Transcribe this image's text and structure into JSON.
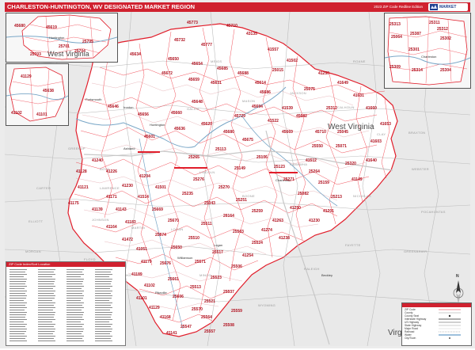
{
  "title": "CHARLESTON-HUNTINGTON, WV DESIGNATED MARKET REGION",
  "edition_note": "2023 ZIP Code Redline Edition",
  "logo_text": "MARKET MAPS",
  "colors": {
    "accent": "#d0212f",
    "zip_label": "#b0101e",
    "state_label": "#4a4a4a"
  },
  "states": {
    "wv_main": "West Virginia",
    "wv_inset": "West Virginia",
    "va": "Virginia"
  },
  "insets": {
    "ne": {
      "place": "Charleston",
      "zips": [
        "25313",
        "25311",
        "25387",
        "25302",
        "25304",
        "25064",
        "25309",
        "25314",
        "25301",
        "25312"
      ]
    },
    "nw": {
      "place": "Huntington",
      "zips": [
        "45680",
        "45619",
        "25705",
        "25704",
        "25701",
        "25703"
      ]
    },
    "w": {
      "zips": [
        "41102",
        "41101",
        "45638",
        "41129"
      ]
    }
  },
  "counties": [
    "LAWRENCE",
    "ROANE",
    "CLAY",
    "KANAWHA",
    "BOONE",
    "LINCOLN",
    "MINGO",
    "RALEIGH",
    "WYOMING",
    "FAYETTE",
    "NICHOLAS",
    "GREENBRIER",
    "POCAHONTAS",
    "WEBSTER",
    "GALLIA",
    "MEIGS",
    "MASON",
    "JACKSON",
    "CALHOUN",
    "BRAXTON",
    "LOGAN",
    "PIKE",
    "MARTIN",
    "JOHNSON",
    "FLOYD",
    "LAWRENCE",
    "BOYD",
    "GREENUP",
    "CARTER",
    "ELLIOTT",
    "MORGAN",
    "MAGOFFIN",
    "ATHENS",
    "VINTON",
    "JACKSON",
    "SCIOTO",
    "WIRT",
    "RITCHIE",
    "GILMER",
    "LEWIS",
    "UPSHUR",
    "RANDOLPH",
    "SUMMERS",
    "MERCER",
    "MCDOWELL",
    "BUCHANAN",
    "TAZEWELL",
    "DICKENSON",
    "WISE",
    "LETCHER",
    "KNOTT",
    "PERRY",
    "BREATHITT",
    "WOLFE",
    "LEE",
    "ESTILL",
    "POWELL",
    "MONTGOMERY",
    "BATH",
    "ROWAN",
    "FLEMING",
    "LEWIS",
    "MASON",
    "ADAMS",
    "PIKE",
    "ROSS",
    "HOCKING",
    "PERRY",
    "MORGAN",
    "WASHINGTON",
    "MONROE",
    "NOBLE",
    "PLEASANTS",
    "TYLER",
    "DODDRIDGE",
    "HARRISON",
    "BARBOUR",
    "TUCKER",
    "PENDLETON",
    "HIGHLAND",
    "BATH",
    "ALLEGHANY",
    "CRAIG",
    "GILES",
    "BLAND",
    "SMYTH",
    "RUSSELL",
    "SCOTT"
  ],
  "places": [
    "Huntington",
    "Charleston",
    "Ashland",
    "Portsmouth",
    "Ironton",
    "Logan",
    "Williamson",
    "Pikeville",
    "Beckley",
    "Summersville",
    "Point Pleasant",
    "Gallipolis",
    "Ripley",
    "Spencer",
    "Glenville",
    "Sutton",
    "Webster Springs",
    "Marlinton",
    "Lewisburg",
    "Hinton",
    "Welch",
    "Pineville",
    "Madison",
    "Hamlin",
    "Wayne",
    "Louisa",
    "Paintsville",
    "Prestonsburg",
    "Hindman",
    "Whitesburg",
    "Jackson",
    "Athens",
    "Pomeroy",
    "Grayson",
    "Olive Hill",
    "Morehead",
    "West Liberty",
    "Salyersville",
    "Hazard"
  ],
  "zips": [
    "45773",
    "45710",
    "43135",
    "45732",
    "45777",
    "45634",
    "45650",
    "45654",
    "45685",
    "45688",
    "45672",
    "45659",
    "45631",
    "45614",
    "45686",
    "45646",
    "45656",
    "45660",
    "45648",
    "45636",
    "45620",
    "45680",
    "45694",
    "45729",
    "45601",
    "45675",
    "45669",
    "45682",
    "45710",
    "25550",
    "25106",
    "25123",
    "25264",
    "25271",
    "25159",
    "25213",
    "25082",
    "25075",
    "25312",
    "25071",
    "25320",
    "25045",
    "25015",
    "25149",
    "25113",
    "25265",
    "25276",
    "25270",
    "25251",
    "25043",
    "25235",
    "25259",
    "26164",
    "25511",
    "25510",
    "25503",
    "25524",
    "25517",
    "25571",
    "25506",
    "25523",
    "25513",
    "25537",
    "25521",
    "25559",
    "25564",
    "25547",
    "25557",
    "25508",
    "25570",
    "25606",
    "25661",
    "25676",
    "25650",
    "25674",
    "25670",
    "25669",
    "41514",
    "41501",
    "41204",
    "41230",
    "41226",
    "41240",
    "41128",
    "41121",
    "41175",
    "41139",
    "41171",
    "41143",
    "41183",
    "41164",
    "41472",
    "41051",
    "41179",
    "41189",
    "41102",
    "41101",
    "41129",
    "41168",
    "41141",
    "41149",
    "41640",
    "41603",
    "41653",
    "41660",
    "41631",
    "41649",
    "41250",
    "41502",
    "41557",
    "41539",
    "41522",
    "41512",
    "41201",
    "41230",
    "41250",
    "41263",
    "41274",
    "41238",
    "41254",
    "41260",
    "45638",
    "45619",
    "45696",
    "45623",
    "25305",
    "25302",
    "25311",
    "25313",
    "25309",
    "25064",
    "25177",
    "25143",
    "25287",
    "25425",
    "25540",
    "25061",
    "25141",
    "25159",
    "25186",
    "25119",
    "25185",
    "25008",
    "25060",
    "25002",
    "25004",
    "25142",
    "25122",
    "25108",
    "25168",
    "26187",
    "26180",
    "26161",
    "26155",
    "26137",
    "26143",
    "26147",
    "26151",
    "26136",
    "25234",
    "25262",
    "25268",
    "25241",
    "25231",
    "25286",
    "25081",
    "25123",
    "25285",
    "25011",
    "25130",
    "25188",
    "25153",
    "25160",
    "25174",
    "25181",
    "25184",
    "26629",
    "26623",
    "26601",
    "26631",
    "26627",
    "25917",
    "25962",
    "25951",
    "25976",
    "26651",
    "26675",
    "26656",
    "26671",
    "26691",
    "26690",
    "26601",
    "26636",
    "26641",
    "25985"
  ],
  "index_panel": {
    "header": "ZIP Code Index/Sort Location"
  },
  "legend": {
    "items": [
      "ZIP Code",
      "County",
      "County Seat",
      "Interstate Highway",
      "US Highway",
      "State Highway",
      "Major Road",
      "Railroad",
      "Water",
      "City/Town"
    ]
  },
  "compass": {
    "label": "N"
  }
}
